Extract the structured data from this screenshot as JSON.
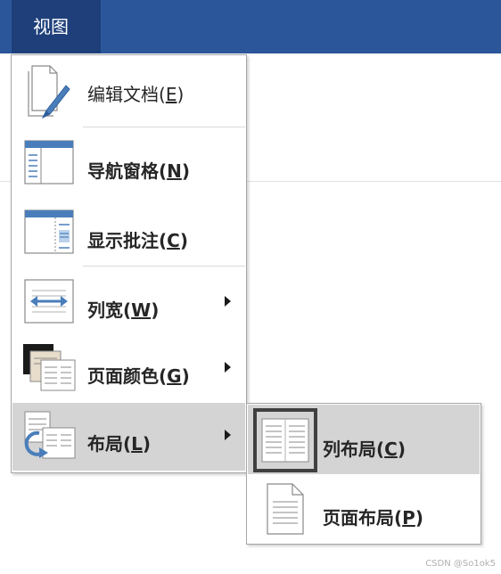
{
  "ribbon": {
    "active_tab": "视图"
  },
  "menu": {
    "items": [
      {
        "label": "编辑文档(",
        "mnemonic": "E",
        "suffix": ")",
        "has_submenu": false,
        "bold": false
      },
      {
        "label": "导航窗格(",
        "mnemonic": "N",
        "suffix": ")",
        "has_submenu": false,
        "bold": true
      },
      {
        "label": "显示批注(",
        "mnemonic": "C",
        "suffix": ")",
        "has_submenu": false,
        "bold": true
      },
      {
        "label": "列宽(",
        "mnemonic": "W",
        "suffix": ")",
        "has_submenu": true,
        "bold": true
      },
      {
        "label": "页面颜色(",
        "mnemonic": "G",
        "suffix": ")",
        "has_submenu": true,
        "bold": true
      },
      {
        "label": "布局(",
        "mnemonic": "L",
        "suffix": ")",
        "has_submenu": true,
        "bold": true,
        "highlighted": true
      }
    ]
  },
  "submenu": {
    "items": [
      {
        "label": "列布局(",
        "mnemonic": "C",
        "suffix": ")",
        "highlighted": true,
        "selected": true
      },
      {
        "label": "页面布局(",
        "mnemonic": "P",
        "suffix": ")",
        "highlighted": false
      }
    ]
  },
  "watermark": "CSDN @So1ok5",
  "colors": {
    "ribbon": "#2b579a",
    "active_tab": "#1e3f7a",
    "highlight": "#d4d4d4",
    "icon_blue": "#4a7ebb"
  }
}
